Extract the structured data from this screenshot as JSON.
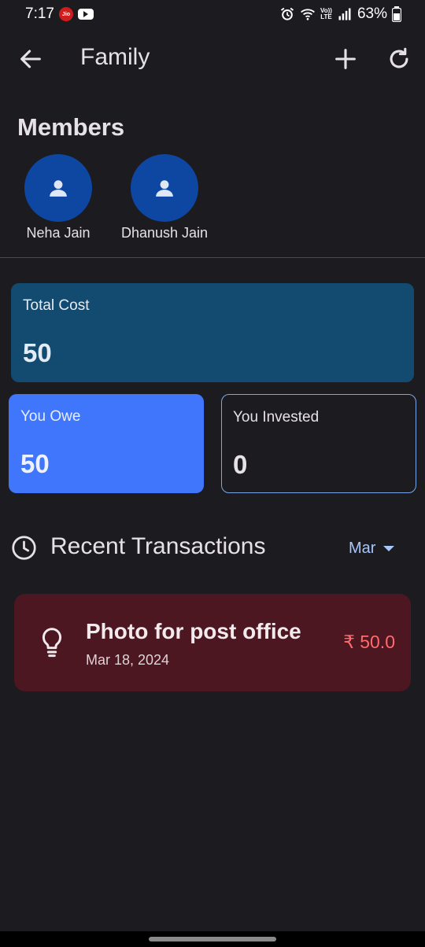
{
  "status_bar": {
    "time": "7:17",
    "carrier_badge": "Jio",
    "volte_line1": "Vo))",
    "volte_line2": "LTE",
    "battery": "63%",
    "icons": [
      "alarm-icon",
      "wifi-icon",
      "signal-icon",
      "battery-icon"
    ]
  },
  "app_bar": {
    "title": "Family",
    "icons": [
      "back-arrow-icon",
      "plus-icon",
      "refresh-icon"
    ]
  },
  "members": {
    "heading": "Members",
    "list": [
      {
        "name": "Neha Jain"
      },
      {
        "name": "Dhanush Jain"
      }
    ]
  },
  "summary": {
    "total_cost": {
      "label": "Total Cost",
      "value": "50"
    },
    "you_owe": {
      "label": "You Owe",
      "value": "50"
    },
    "you_invested": {
      "label": "You Invested",
      "value": "0"
    }
  },
  "recent": {
    "heading": "Recent Transactions",
    "month_filter": "Mar"
  },
  "transactions": [
    {
      "title": "Photo for post office",
      "date": "Mar 18, 2024",
      "amount": "₹ 50.0",
      "icon": "lightbulb-icon"
    }
  ],
  "colors": {
    "background": "#1c1b20",
    "total_card": "#134a70",
    "owe_card": "#3f76fc",
    "avatar": "#0d47a1",
    "transaction_card": "#4c1720",
    "amount_text": "#ff6b6b",
    "accent": "#a8c6fa"
  }
}
